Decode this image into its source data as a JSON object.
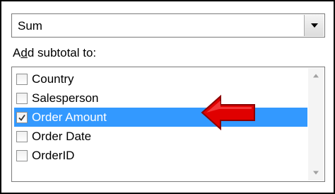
{
  "summary_function": {
    "selected_value": "Sum",
    "dropdown_icon": "chevron-down-icon"
  },
  "subtotal": {
    "caption_accesskey": "d",
    "caption_prefix": "A",
    "caption_suffix": "d subtotal to:",
    "items": [
      {
        "label": "Country",
        "checked": false,
        "selected": false
      },
      {
        "label": "Salesperson",
        "checked": false,
        "selected": false
      },
      {
        "label": "Order Amount",
        "checked": true,
        "selected": true
      },
      {
        "label": "Order Date",
        "checked": false,
        "selected": false
      },
      {
        "label": "OrderID",
        "checked": false,
        "selected": false
      }
    ]
  },
  "colors": {
    "selection": "#3399ff",
    "annotation_arrow": "#e00000"
  }
}
